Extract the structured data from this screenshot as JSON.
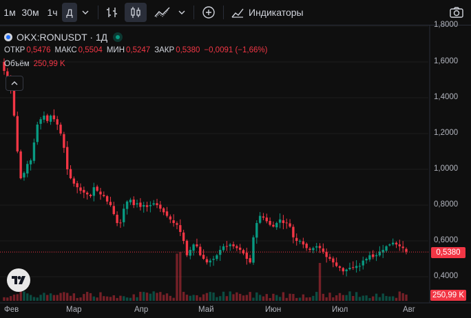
{
  "toolbar": {
    "intervals": [
      "1м",
      "30м",
      "1ч",
      "Д"
    ],
    "active_interval": "Д",
    "indicators_label": "Индикаторы"
  },
  "legend": {
    "symbol": "OKX:RONUSDT · 1Д",
    "open_label": "ОТКР",
    "open": "0,5476",
    "high_label": "МАКС",
    "high": "0,5504",
    "low_label": "МИН",
    "low": "0,5247",
    "close_label": "ЗАКР",
    "close": "0,5380",
    "change": "−0,0091 (−1,66%)",
    "volume_label": "Объём",
    "volume": "250,99 K"
  },
  "price_scale": {
    "labels": [
      "1,8000",
      "1,6000",
      "1,4000",
      "1,2000",
      "1,0000",
      "0,8000",
      "0,6000",
      "0,4000"
    ],
    "last_price_tag": "0,5380",
    "volume_tag": "250,99 K"
  },
  "time_scale": [
    "Фев",
    "Мар",
    "Апр",
    "Май",
    "Июн",
    "Июл",
    "Авг"
  ],
  "colors": {
    "up": "#089981",
    "down": "#f23645",
    "background": "#0f0f0f"
  },
  "chart_data": {
    "type": "candlestick",
    "symbol": "OKX:RONUSDT",
    "interval": "1Д",
    "ylim": [
      0.3,
      1.85
    ],
    "close_series": [
      1.55,
      1.5,
      1.44,
      1.3,
      1.1,
      0.95,
      0.98,
      1.03,
      1.05,
      1.15,
      1.25,
      1.28,
      1.3,
      1.27,
      1.3,
      1.28,
      1.25,
      1.2,
      1.12,
      1.0,
      0.95,
      0.92,
      0.9,
      0.88,
      0.87,
      0.86,
      0.85,
      0.9,
      0.88,
      0.86,
      0.85,
      0.82,
      0.8,
      0.75,
      0.7,
      0.7,
      0.78,
      0.82,
      0.83,
      0.8,
      0.81,
      0.79,
      0.8,
      0.79,
      0.8,
      0.81,
      0.8,
      0.78,
      0.76,
      0.74,
      0.72,
      0.7,
      0.69,
      0.65,
      0.6,
      0.52,
      0.55,
      0.58,
      0.57,
      0.52,
      0.5,
      0.48,
      0.49,
      0.5,
      0.52,
      0.55,
      0.57,
      0.57,
      0.58,
      0.57,
      0.56,
      0.55,
      0.53,
      0.5,
      0.48,
      0.62,
      0.7,
      0.74,
      0.73,
      0.71,
      0.69,
      0.68,
      0.7,
      0.72,
      0.7,
      0.7,
      0.68,
      0.62,
      0.6,
      0.6,
      0.58,
      0.56,
      0.55,
      0.56,
      0.57,
      0.56,
      0.54,
      0.51,
      0.5,
      0.48,
      0.46,
      0.45,
      0.43,
      0.44,
      0.45,
      0.45,
      0.46,
      0.46,
      0.49,
      0.5,
      0.52,
      0.51,
      0.52,
      0.54,
      0.55,
      0.57,
      0.58,
      0.59,
      0.58,
      0.57,
      0.56,
      0.54
    ],
    "last_close": 0.538,
    "last_volume": "250,99 K"
  }
}
